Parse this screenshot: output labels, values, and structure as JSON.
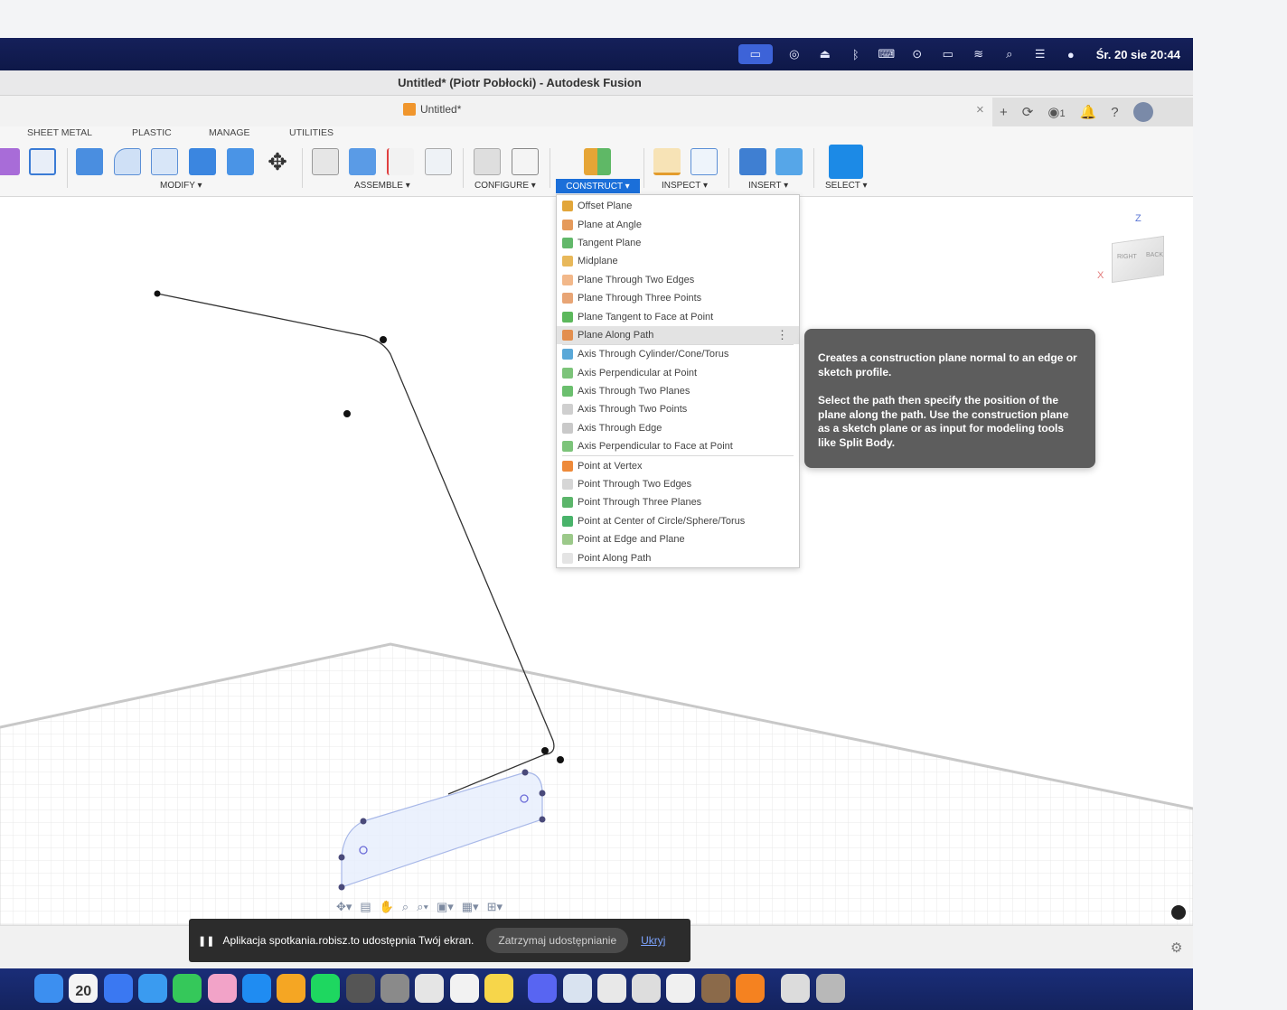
{
  "menubar": {
    "clock": "Śr. 20 sie  20:44",
    "icons": [
      "screen-mirror-icon",
      "vpn-icon",
      "drive-icon",
      "bluetooth-icon",
      "keyboard-icon",
      "record-icon",
      "battery-icon",
      "wifi-icon",
      "spotlight-icon",
      "control-center-icon",
      "siri-icon"
    ]
  },
  "window": {
    "title": "Untitled* (Piotr Pobłocki) - Autodesk Fusion"
  },
  "tabbar": {
    "document_tab": "Untitled*",
    "job_count": "1"
  },
  "toolbar": {
    "tabs": [
      "SHEET METAL",
      "PLASTIC",
      "MANAGE",
      "UTILITIES"
    ],
    "groups": [
      "MODIFY ▾",
      "ASSEMBLE ▾",
      "CONFIGURE ▾",
      "CONSTRUCT ▾",
      "INSPECT ▾",
      "INSERT ▾",
      "SELECT ▾"
    ]
  },
  "viewcube": {
    "right": "RIGHT",
    "back": "BACK",
    "axis_z": "Z",
    "axis_x": "X"
  },
  "construct_menu": {
    "items": [
      {
        "label": "Offset Plane",
        "icon": "offset-plane-icon",
        "color": "#e2a63a"
      },
      {
        "label": "Plane at Angle",
        "icon": "plane-at-angle-icon",
        "color": "#e59a5b"
      },
      {
        "label": "Tangent Plane",
        "icon": "tangent-plane-icon",
        "color": "#62b86a"
      },
      {
        "label": "Midplane",
        "icon": "midplane-icon",
        "color": "#e8b85a"
      },
      {
        "label": "Plane Through Two Edges",
        "icon": "plane-two-edges-icon",
        "color": "#f2b88a"
      },
      {
        "label": "Plane Through Three Points",
        "icon": "plane-three-points-icon",
        "color": "#e8a575"
      },
      {
        "label": "Plane Tangent to Face at Point",
        "icon": "plane-tangent-face-icon",
        "color": "#5cb85c"
      },
      {
        "label": "Plane Along Path",
        "icon": "plane-along-path-icon",
        "color": "#e38f4f"
      },
      {
        "label": "Axis Through Cylinder/Cone/Torus",
        "icon": "axis-cylinder-icon",
        "color": "#5aa8d8"
      },
      {
        "label": "Axis Perpendicular at Point",
        "icon": "axis-perpendicular-icon",
        "color": "#7cc47a"
      },
      {
        "label": "Axis Through Two Planes",
        "icon": "axis-two-planes-icon",
        "color": "#6bbf6e"
      },
      {
        "label": "Axis Through Two Points",
        "icon": "axis-two-points-icon",
        "color": "#cfcfcf"
      },
      {
        "label": "Axis Through Edge",
        "icon": "axis-edge-icon",
        "color": "#c9c9c9"
      },
      {
        "label": "Axis Perpendicular to Face at Point",
        "icon": "axis-perp-face-icon",
        "color": "#7cc47a"
      },
      {
        "label": "Point at Vertex",
        "icon": "point-vertex-icon",
        "color": "#ee8a3a"
      },
      {
        "label": "Point Through Two Edges",
        "icon": "point-two-edges-icon",
        "color": "#d6d6d6"
      },
      {
        "label": "Point Through Three Planes",
        "icon": "point-three-planes-icon",
        "color": "#5bb56a"
      },
      {
        "label": "Point at Center of Circle/Sphere/Torus",
        "icon": "point-center-icon",
        "color": "#49b36a"
      },
      {
        "label": "Point at Edge and Plane",
        "icon": "point-edge-plane-icon",
        "color": "#9cc98a"
      },
      {
        "label": "Point Along Path",
        "icon": "point-along-path-icon",
        "color": "#e4e4e4"
      }
    ],
    "highlighted": "Plane Along Path"
  },
  "tooltip": {
    "line1": "Creates a construction plane normal to an edge or sketch profile.",
    "line2": "Select the path then specify the position of the plane along the path. Use the construction plane as a sketch plane or as input for modeling tools like Split Body."
  },
  "screen_share": {
    "message": "Aplikacja spotkania.robisz.to udostępnia Twój ekran.",
    "stop_label": "Zatrzymaj udostępnianie",
    "hide_label": "Ukryj"
  },
  "dock": {
    "calendar_day": "20",
    "apps": [
      "finder-icon",
      "calendar-icon",
      "signal-icon",
      "safari-icon",
      "messages-icon",
      "photos-icon",
      "app-store-icon",
      "pages-icon",
      "spotify-icon",
      "calculator-icon",
      "system-settings-icon",
      "fusion-icon",
      "stack-icon",
      "notes-icon",
      "discord-icon",
      "preview-icon",
      "chrome-icon",
      "chatgpt-icon",
      "textedit-icon",
      "automator-icon",
      "fusion-app-icon",
      "files-icon",
      "trash-icon"
    ]
  },
  "colors": {
    "accent": "#1b6fd9",
    "menubar": "#15205a",
    "tooltip_bg": "#5d5d5d"
  }
}
